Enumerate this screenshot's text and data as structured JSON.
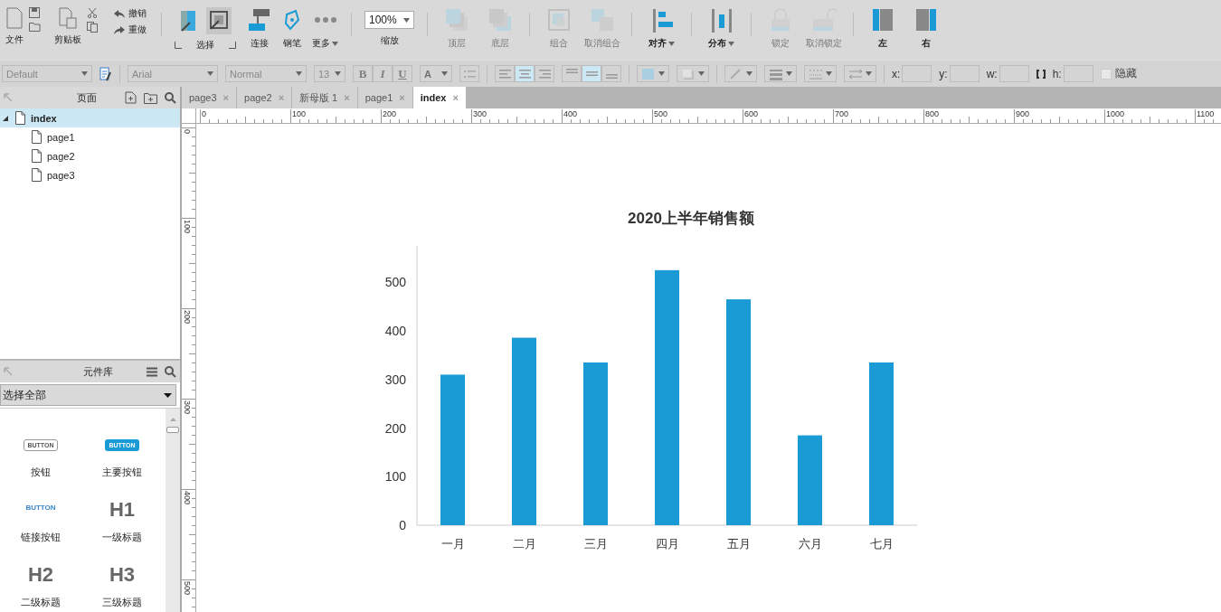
{
  "toolbar": {
    "file": "文件",
    "clipboard": "剪贴板",
    "undo": "撤销",
    "redo": "重做",
    "select": {
      "label": "选择",
      "selected": true
    },
    "connect": "连接",
    "pen": "钢笔",
    "more": "更多",
    "zoom": {
      "value": "100%",
      "label": "缩放"
    },
    "arrange": [
      {
        "kind": "front",
        "label": "顶层",
        "disabled": true
      },
      {
        "kind": "back",
        "label": "底层",
        "disabled": true
      },
      {
        "kind": "group",
        "label": "组合",
        "disabled": true
      },
      {
        "kind": "ungroup",
        "label": "取消组合",
        "disabled": true
      },
      {
        "kind": "align",
        "label": "对齐",
        "disabled": false
      },
      {
        "kind": "distribute",
        "label": "分布",
        "disabled": false
      },
      {
        "kind": "lock",
        "label": "锁定",
        "disabled": true
      },
      {
        "kind": "unlock",
        "label": "取消锁定",
        "disabled": true
      },
      {
        "kind": "left",
        "label": "左",
        "disabled": false
      },
      {
        "kind": "right",
        "label": "右",
        "disabled": false
      }
    ]
  },
  "format_bar": {
    "style": "Default",
    "font": "Arial",
    "weight": "Normal",
    "size": "13",
    "text_styles": [
      {
        "label": "B",
        "disabled": true
      },
      {
        "label": "I",
        "disabled": true
      },
      {
        "label": "U",
        "disabled": true
      }
    ],
    "font_color": "A",
    "h_align": [
      {
        "selected": false
      },
      {
        "selected": true
      },
      {
        "selected": false
      }
    ],
    "v_align": [
      {
        "selected": false
      },
      {
        "selected": true
      },
      {
        "selected": false
      }
    ],
    "coords": [
      {
        "label": "x:"
      },
      {
        "label": "y:"
      },
      {
        "label": "w:"
      },
      {
        "label": "h:"
      }
    ],
    "hidden": {
      "label": "隐藏",
      "checked": false
    }
  },
  "pages_panel": {
    "title": "页面",
    "pages": [
      {
        "label": "index",
        "selected": true,
        "expanded": true,
        "children": [
          {
            "label": "page1",
            "selected": false
          },
          {
            "label": "page2",
            "selected": false
          },
          {
            "label": "page3",
            "selected": false
          }
        ]
      }
    ]
  },
  "library_panel": {
    "title": "元件库",
    "filter": "选择全部",
    "items": [
      {
        "kind": "button",
        "preview": "BUTTON",
        "label": "按钮"
      },
      {
        "kind": "primary",
        "preview": "BUTTON",
        "label": "主要按钮"
      },
      {
        "kind": "link",
        "preview": "BUTTON",
        "label": "链接按钮"
      },
      {
        "kind": "heading",
        "preview": "H1",
        "label": "一级标题"
      },
      {
        "kind": "heading",
        "preview": "H2",
        "label": "二级标题"
      },
      {
        "kind": "heading",
        "preview": "H3",
        "label": "三级标题"
      }
    ]
  },
  "tabs": [
    {
      "label": "page3",
      "close": "×",
      "selected": false
    },
    {
      "label": "page2",
      "close": "×",
      "selected": false
    },
    {
      "label": "新母版 1",
      "close": "×",
      "selected": false
    },
    {
      "label": "page1",
      "close": "×",
      "selected": false
    },
    {
      "label": "index",
      "close": "×",
      "selected": true
    }
  ],
  "rulers": {
    "horizontal": [
      "0",
      "100",
      "200",
      "300",
      "400",
      "500",
      "600",
      "700",
      "800",
      "900",
      "1000",
      "1100"
    ],
    "vertical": [
      "0",
      "100",
      "200",
      "300",
      "400",
      "500"
    ]
  },
  "canvas": {
    "chart_data": {
      "type": "bar",
      "title": "2020上半年销售额",
      "categories": [
        "一月",
        "二月",
        "三月",
        "四月",
        "五月",
        "六月",
        "七月"
      ],
      "series": [
        {
          "color": "#1b9bd5",
          "values": [
            310,
            386,
            335,
            525,
            465,
            185,
            335
          ]
        }
      ],
      "ylim": [
        0,
        575
      ],
      "yticks": [
        0,
        100,
        200,
        300,
        400,
        500
      ]
    }
  }
}
